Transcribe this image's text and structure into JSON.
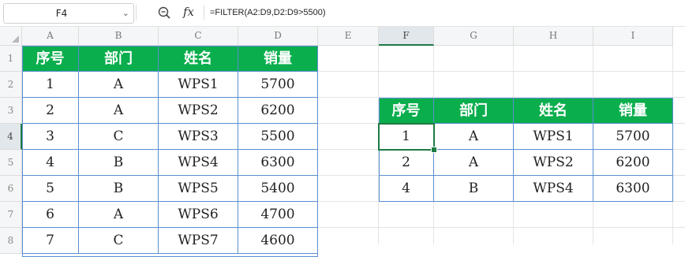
{
  "formula_bar": {
    "cell_ref": "F4",
    "fx_label": "fx",
    "formula": "=FILTER(A2:D9,D2:D9>5500)"
  },
  "columns": [
    "A",
    "B",
    "C",
    "D",
    "E",
    "F",
    "G",
    "H",
    "I"
  ],
  "rows": [
    "1",
    "2",
    "3",
    "4",
    "5",
    "6",
    "7",
    "8"
  ],
  "source_table": {
    "headers": [
      "序号",
      "部门",
      "姓名",
      "销量"
    ],
    "rows": [
      [
        "1",
        "A",
        "WPS1",
        "5700"
      ],
      [
        "2",
        "A",
        "WPS2",
        "6200"
      ],
      [
        "3",
        "C",
        "WPS3",
        "5500"
      ],
      [
        "4",
        "B",
        "WPS4",
        "6300"
      ],
      [
        "5",
        "B",
        "WPS5",
        "5400"
      ],
      [
        "6",
        "A",
        "WPS6",
        "4700"
      ],
      [
        "7",
        "C",
        "WPS7",
        "4600"
      ]
    ]
  },
  "result_table": {
    "headers": [
      "序号",
      "部门",
      "姓名",
      "销量"
    ],
    "rows": [
      [
        "1",
        "A",
        "WPS1",
        "5700"
      ],
      [
        "2",
        "A",
        "WPS2",
        "6200"
      ],
      [
        "4",
        "B",
        "WPS4",
        "6300"
      ]
    ]
  },
  "active_cell": "F4",
  "colors": {
    "header_fill": "#0aae4d",
    "table_border": "#5b8fd1",
    "selection": "#1e7a45"
  }
}
